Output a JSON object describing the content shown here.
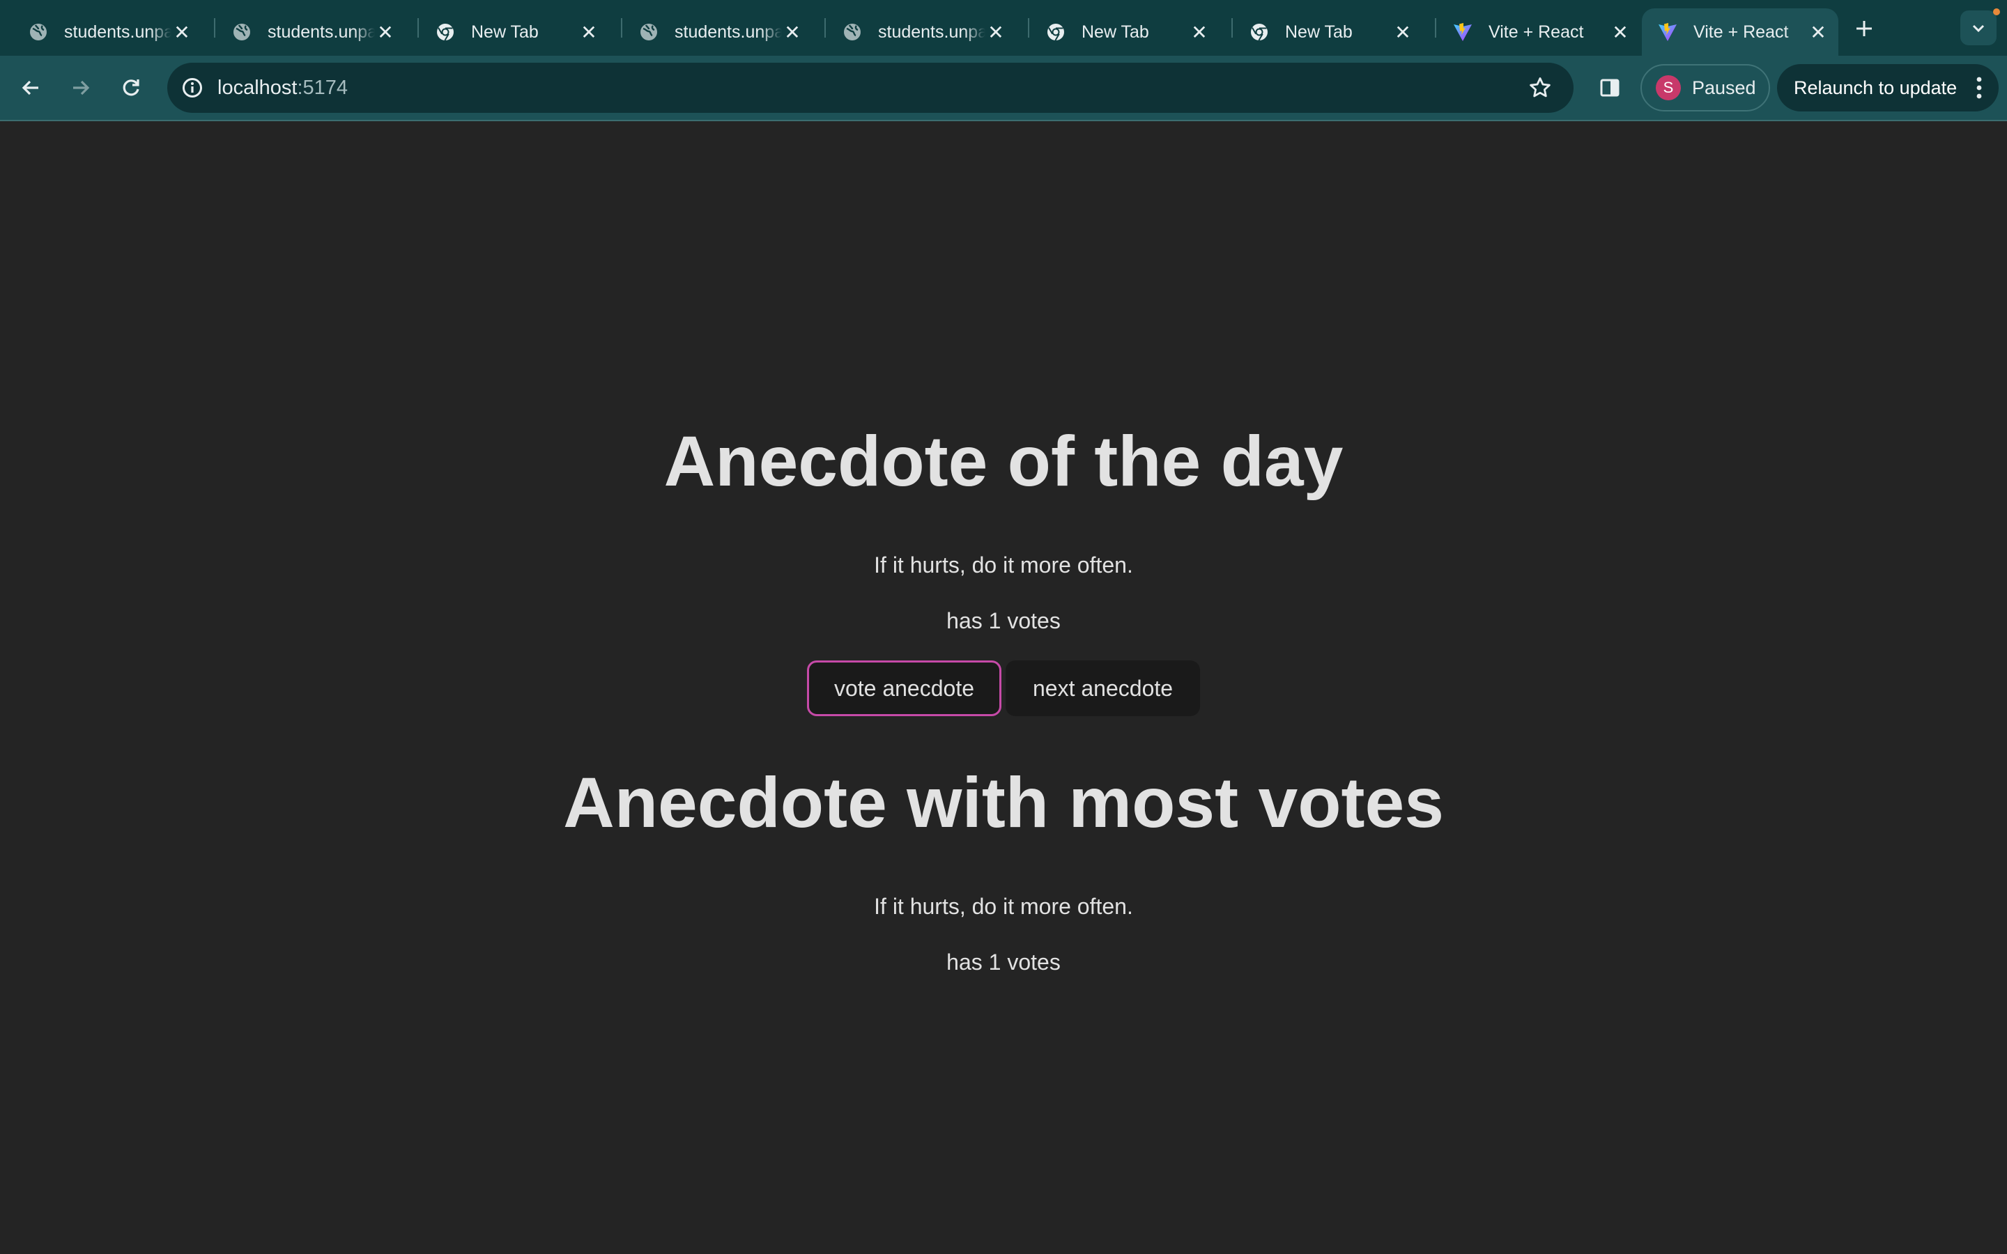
{
  "browser": {
    "tabs": [
      {
        "title": "students.unpad.ac.id",
        "icon": "globe-icon",
        "active": false
      },
      {
        "title": "students.unpad.ac.id",
        "icon": "globe-icon",
        "active": false
      },
      {
        "title": "New Tab",
        "icon": "chrome-icon",
        "active": false
      },
      {
        "title": "students.unpad.ac.id",
        "icon": "globe-icon",
        "active": false
      },
      {
        "title": "students.unpad.ac.id",
        "icon": "globe-icon",
        "active": false
      },
      {
        "title": "New Tab",
        "icon": "chrome-icon",
        "active": false
      },
      {
        "title": "New Tab",
        "icon": "chrome-icon",
        "active": false
      },
      {
        "title": "Vite + React",
        "icon": "vite-icon",
        "active": false
      },
      {
        "title": "Vite + React",
        "icon": "vite-icon",
        "active": true
      }
    ],
    "address": {
      "host": "localhost",
      "port": ":5174"
    },
    "profile": {
      "initial": "S",
      "status": "Paused"
    },
    "relaunch_label": "Relaunch to update",
    "colors": {
      "frame": "#0f3d40",
      "toolbar": "#1d5257",
      "avatar": "#c8396a",
      "update_dot": "#e8893a"
    }
  },
  "app": {
    "day_heading": "Anecdote of the day",
    "day_anecdote": "If it hurts, do it more often.",
    "day_votes": "has 1 votes",
    "vote_button": "vote anecdote",
    "next_button": "next anecdote",
    "most_heading": "Anecdote with most votes",
    "most_anecdote": "If it hurts, do it more often.",
    "most_votes": "has 1 votes",
    "colors": {
      "background": "#242424",
      "button": "#1a1a1a",
      "focus_ring": "#c64aa8"
    }
  }
}
